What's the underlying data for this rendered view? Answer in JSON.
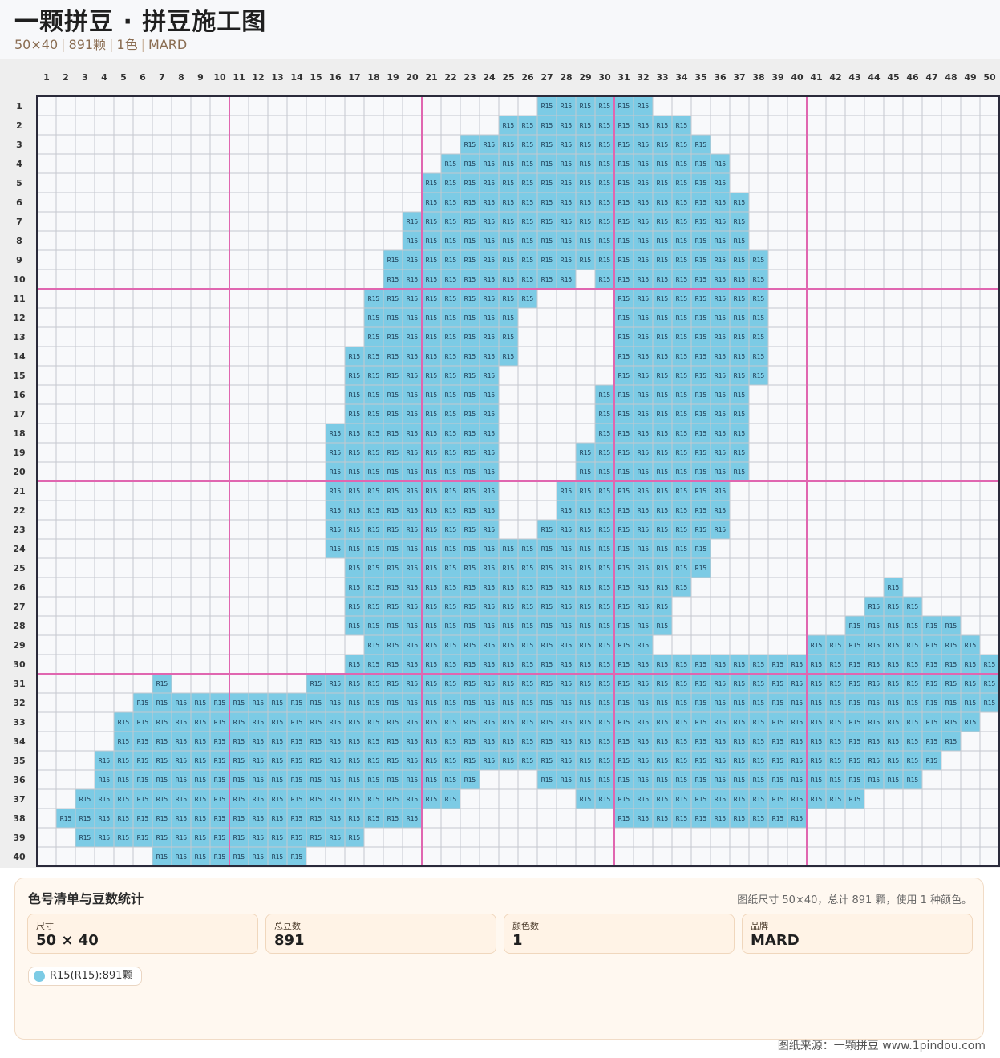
{
  "header": {
    "title": "一颗拼豆 · 拼豆施工图",
    "sub_size": "50×40",
    "sub_count": "891颗",
    "sub_colors": "1色",
    "sub_brand": "MARD"
  },
  "pattern": {
    "cols": 50,
    "rows": 40,
    "color_code": "R15",
    "color_hex": "#7ccbe5",
    "major_line_color": "#e066b0",
    "major_every": 10,
    "col_labels": [
      "1",
      "2",
      "3",
      "4",
      "5",
      "6",
      "7",
      "8",
      "9",
      "10",
      "11",
      "12",
      "13",
      "14",
      "15",
      "16",
      "17",
      "18",
      "19",
      "20",
      "21",
      "22",
      "23",
      "24",
      "25",
      "26",
      "27",
      "28",
      "29",
      "30",
      "31",
      "32",
      "33",
      "34",
      "35",
      "36",
      "37",
      "38",
      "39",
      "40",
      "41",
      "42",
      "43",
      "44",
      "45",
      "46",
      "47",
      "48",
      "49",
      "50"
    ],
    "row_labels": [
      "1",
      "2",
      "3",
      "4",
      "5",
      "6",
      "7",
      "8",
      "9",
      "10",
      "11",
      "12",
      "13",
      "14",
      "15",
      "16",
      "17",
      "18",
      "19",
      "20",
      "21",
      "22",
      "23",
      "24",
      "25",
      "26",
      "27",
      "28",
      "29",
      "30",
      "31",
      "32",
      "33",
      "34",
      "35",
      "36",
      "37",
      "38",
      "39",
      "40"
    ],
    "filled_runs": [
      [
        [
          27,
          32
        ]
      ],
      [
        [
          25,
          34
        ]
      ],
      [
        [
          23,
          35
        ]
      ],
      [
        [
          22,
          36
        ]
      ],
      [
        [
          21,
          36
        ]
      ],
      [
        [
          21,
          37
        ]
      ],
      [
        [
          20,
          37
        ]
      ],
      [
        [
          20,
          37
        ]
      ],
      [
        [
          19,
          38
        ]
      ],
      [
        [
          19,
          28
        ],
        [
          30,
          38
        ]
      ],
      [
        [
          18,
          26
        ],
        [
          31,
          38
        ]
      ],
      [
        [
          18,
          25
        ],
        [
          31,
          38
        ]
      ],
      [
        [
          18,
          25
        ],
        [
          31,
          38
        ]
      ],
      [
        [
          17,
          25
        ],
        [
          31,
          38
        ]
      ],
      [
        [
          17,
          24
        ],
        [
          31,
          38
        ]
      ],
      [
        [
          17,
          24
        ],
        [
          30,
          37
        ]
      ],
      [
        [
          17,
          24
        ],
        [
          30,
          37
        ]
      ],
      [
        [
          16,
          24
        ],
        [
          30,
          37
        ]
      ],
      [
        [
          16,
          24
        ],
        [
          29,
          37
        ]
      ],
      [
        [
          16,
          24
        ],
        [
          29,
          37
        ]
      ],
      [
        [
          16,
          24
        ],
        [
          28,
          36
        ]
      ],
      [
        [
          16,
          24
        ],
        [
          28,
          36
        ]
      ],
      [
        [
          16,
          24
        ],
        [
          27,
          36
        ]
      ],
      [
        [
          16,
          35
        ]
      ],
      [
        [
          17,
          35
        ]
      ],
      [
        [
          17,
          34
        ],
        [
          45,
          45
        ]
      ],
      [
        [
          17,
          33
        ],
        [
          44,
          46
        ]
      ],
      [
        [
          17,
          33
        ],
        [
          43,
          48
        ]
      ],
      [
        [
          18,
          32
        ],
        [
          41,
          49
        ]
      ],
      [
        [
          17,
          50
        ]
      ],
      [
        [
          7,
          7
        ],
        [
          15,
          51
        ]
      ],
      [
        [
          6,
          50
        ]
      ],
      [
        [
          5,
          49
        ]
      ],
      [
        [
          5,
          48
        ]
      ],
      [
        [
          4,
          47
        ]
      ],
      [
        [
          4,
          23
        ],
        [
          27,
          46
        ]
      ],
      [
        [
          3,
          22
        ],
        [
          29,
          43
        ]
      ],
      [
        [
          2,
          20
        ],
        [
          31,
          40
        ]
      ],
      [
        [
          3,
          17
        ]
      ],
      [
        [
          7,
          14
        ]
      ]
    ]
  },
  "panel": {
    "title": "色号清单与豆数统计",
    "summary": "图纸尺寸 50×40，总计 891 颗，使用 1 种颜色。",
    "stats": [
      {
        "label": "尺寸",
        "value": "50 × 40"
      },
      {
        "label": "总豆数",
        "value": "891"
      },
      {
        "label": "颜色数",
        "value": "1"
      },
      {
        "label": "品牌",
        "value": "MARD"
      }
    ],
    "legend": [
      {
        "text": "R15(R15):891颗",
        "color": "#7ccbe5"
      }
    ]
  },
  "footer": {
    "source": "图纸来源：一颗拼豆 www.1pindou.com"
  }
}
